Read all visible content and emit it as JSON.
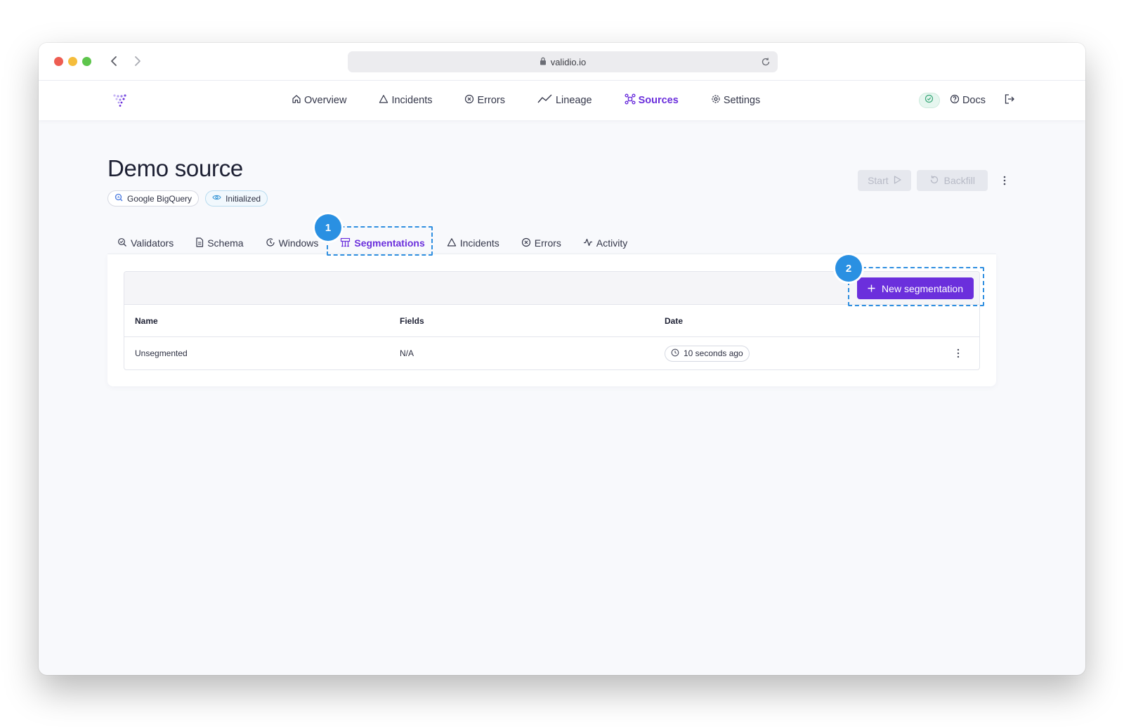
{
  "browser": {
    "url": "validio.io"
  },
  "nav": {
    "items": [
      {
        "label": "Overview",
        "icon": "home-icon"
      },
      {
        "label": "Incidents",
        "icon": "warning-icon"
      },
      {
        "label": "Errors",
        "icon": "error-circle-icon"
      },
      {
        "label": "Lineage",
        "icon": "lineage-icon"
      },
      {
        "label": "Sources",
        "icon": "sources-icon",
        "active": true
      },
      {
        "label": "Settings",
        "icon": "gear-icon"
      }
    ],
    "docs_label": "Docs"
  },
  "page": {
    "title": "Demo source",
    "badges": [
      {
        "label": "Google BigQuery",
        "icon": "bigquery-icon"
      },
      {
        "label": "Initialized",
        "icon": "eye-icon"
      }
    ],
    "actions": {
      "start_label": "Start",
      "backfill_label": "Backfill"
    }
  },
  "tabs": [
    {
      "label": "Validators",
      "icon": "validators-icon"
    },
    {
      "label": "Schema",
      "icon": "document-icon"
    },
    {
      "label": "Windows",
      "icon": "clock-icon"
    },
    {
      "label": "Segmentations",
      "icon": "segmentation-icon",
      "active": true
    },
    {
      "label": "Incidents",
      "icon": "warning-icon"
    },
    {
      "label": "Errors",
      "icon": "error-circle-icon"
    },
    {
      "label": "Activity",
      "icon": "activity-icon"
    }
  ],
  "table": {
    "new_button_label": "New segmentation",
    "columns": [
      "Name",
      "Fields",
      "Date"
    ],
    "rows": [
      {
        "name": "Unsegmented",
        "fields": "N/A",
        "date": "10 seconds ago"
      }
    ]
  },
  "annotations": {
    "step1": "1",
    "step2": "2"
  },
  "colors": {
    "accent": "#6b2fdc",
    "annotation": "#2a90e2"
  }
}
